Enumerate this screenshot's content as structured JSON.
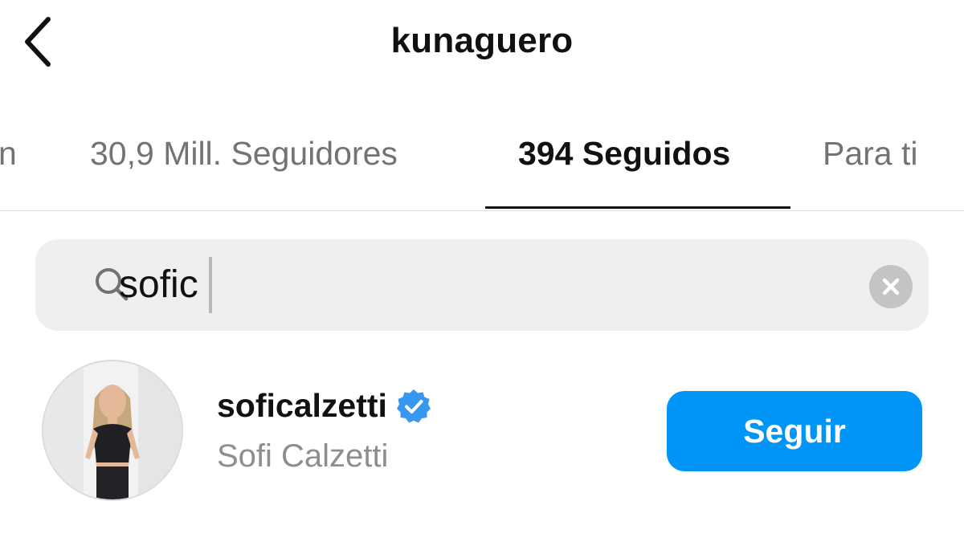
{
  "header": {
    "title": "kunaguero",
    "back_icon": "chevron-left-icon"
  },
  "tabs": {
    "partial_left": "n",
    "followers": "30,9 Mill. Seguidores",
    "following": "394 Seguidos",
    "for_you": "Para ti",
    "active": "following"
  },
  "search": {
    "value": "sofic",
    "search_icon": "search-icon",
    "clear_icon": "clear-icon"
  },
  "results": [
    {
      "username": "soficalzetti",
      "verified": true,
      "full_name": "Sofi Calzetti",
      "follow_label": "Seguir"
    }
  ],
  "colors": {
    "accent": "#0095f6",
    "verified": "#3897f0",
    "text_primary": "#111111",
    "text_secondary": "#8e8e8e",
    "search_bg": "#efefef"
  }
}
